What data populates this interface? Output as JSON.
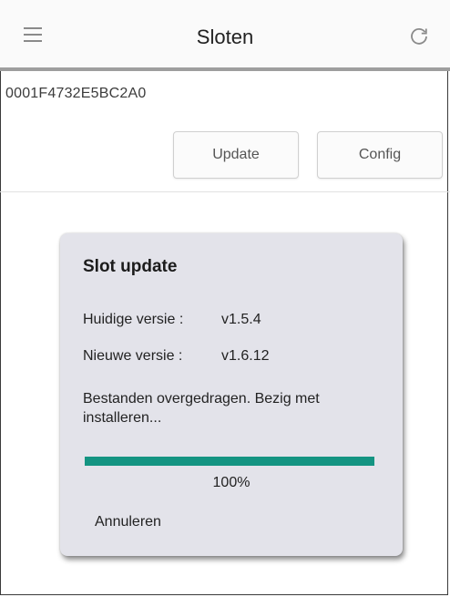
{
  "appbar": {
    "title": "Sloten",
    "menu_icon": "hamburger-menu-icon",
    "refresh_icon": "refresh-icon"
  },
  "device": {
    "id": "0001F4732E5BC2A0"
  },
  "actions": {
    "update_label": "Update",
    "config_label": "Config"
  },
  "dialog": {
    "title": "Slot update",
    "current_label": "Huidige versie :",
    "current_value": "v1.5.4",
    "new_label": "Nieuwe versie :",
    "new_value": "v1.6.12",
    "status": "Bestanden overgedragen. Bezig met installeren...",
    "progress_fraction": 1.0,
    "progress_text": "100%",
    "cancel_label": "Annuleren",
    "accent_color": "#149482"
  }
}
